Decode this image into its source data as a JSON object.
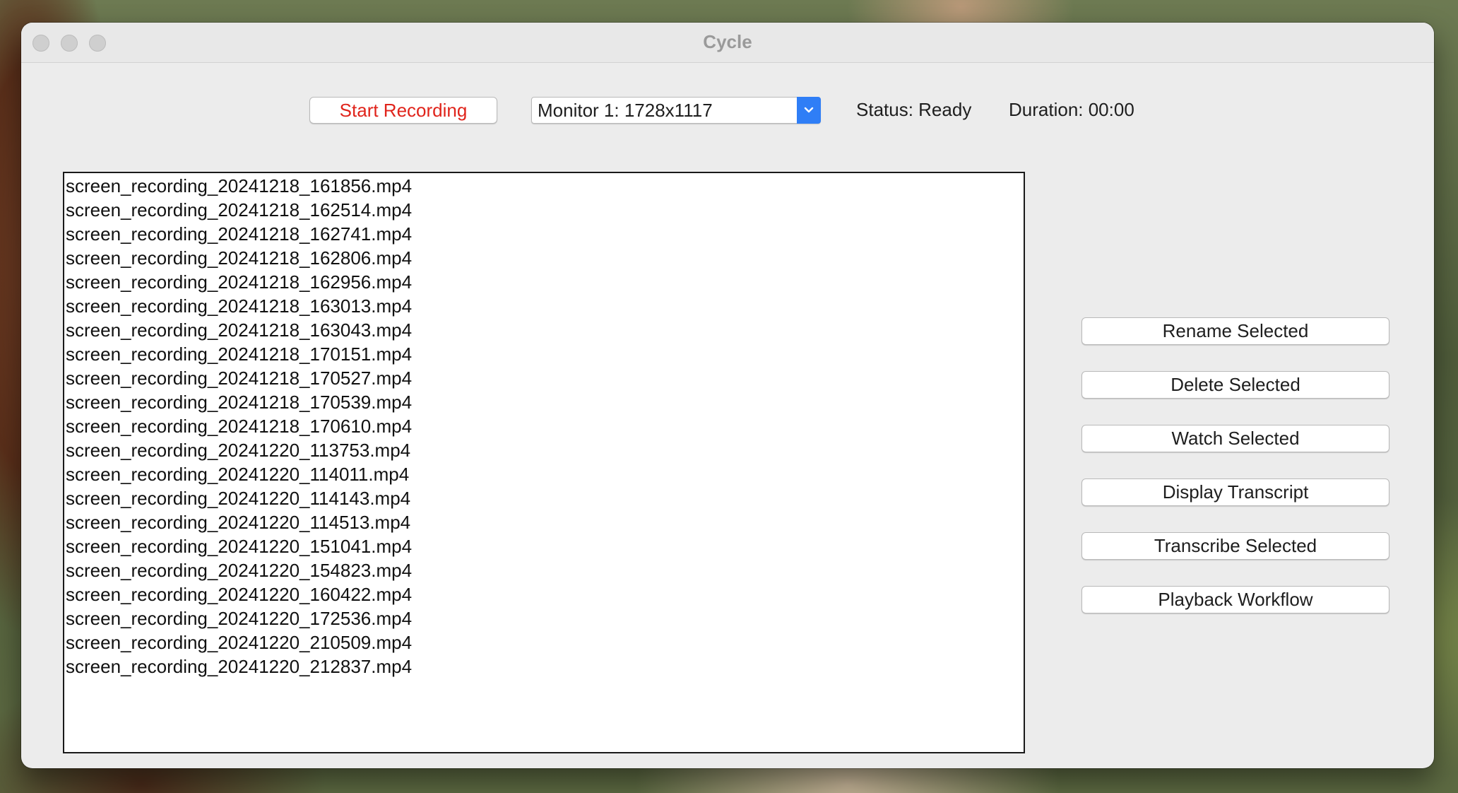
{
  "window": {
    "title": "Cycle"
  },
  "toolbar": {
    "record_label": "Start Recording",
    "monitor_select_value": "Monitor 1: 1728x1117",
    "status_text": "Status: Ready",
    "duration_text": "Duration: 00:00"
  },
  "recordings": [
    "screen_recording_20241218_161856.mp4",
    "screen_recording_20241218_162514.mp4",
    "screen_recording_20241218_162741.mp4",
    "screen_recording_20241218_162806.mp4",
    "screen_recording_20241218_162956.mp4",
    "screen_recording_20241218_163013.mp4",
    "screen_recording_20241218_163043.mp4",
    "screen_recording_20241218_170151.mp4",
    "screen_recording_20241218_170527.mp4",
    "screen_recording_20241218_170539.mp4",
    "screen_recording_20241218_170610.mp4",
    "screen_recording_20241220_113753.mp4",
    "screen_recording_20241220_114011.mp4",
    "screen_recording_20241220_114143.mp4",
    "screen_recording_20241220_114513.mp4",
    "screen_recording_20241220_151041.mp4",
    "screen_recording_20241220_154823.mp4",
    "screen_recording_20241220_160422.mp4",
    "screen_recording_20241220_172536.mp4",
    "screen_recording_20241220_210509.mp4",
    "screen_recording_20241220_212837.mp4"
  ],
  "actions": {
    "rename_label": "Rename Selected",
    "delete_label": "Delete Selected",
    "watch_label": "Watch Selected",
    "transcript_label": "Display Transcript",
    "transcribe_label": "Transcribe Selected",
    "playback_label": "Playback Workflow"
  },
  "colors": {
    "record_text": "#e0241b",
    "dropdown_accent": "#2f7ef6",
    "window_bg": "#ececec"
  },
  "icons": {
    "close": "traffic-light-close-icon",
    "minimize": "traffic-light-minimize-icon",
    "zoom": "traffic-light-zoom-icon",
    "dropdown": "chevron-down-icon"
  }
}
